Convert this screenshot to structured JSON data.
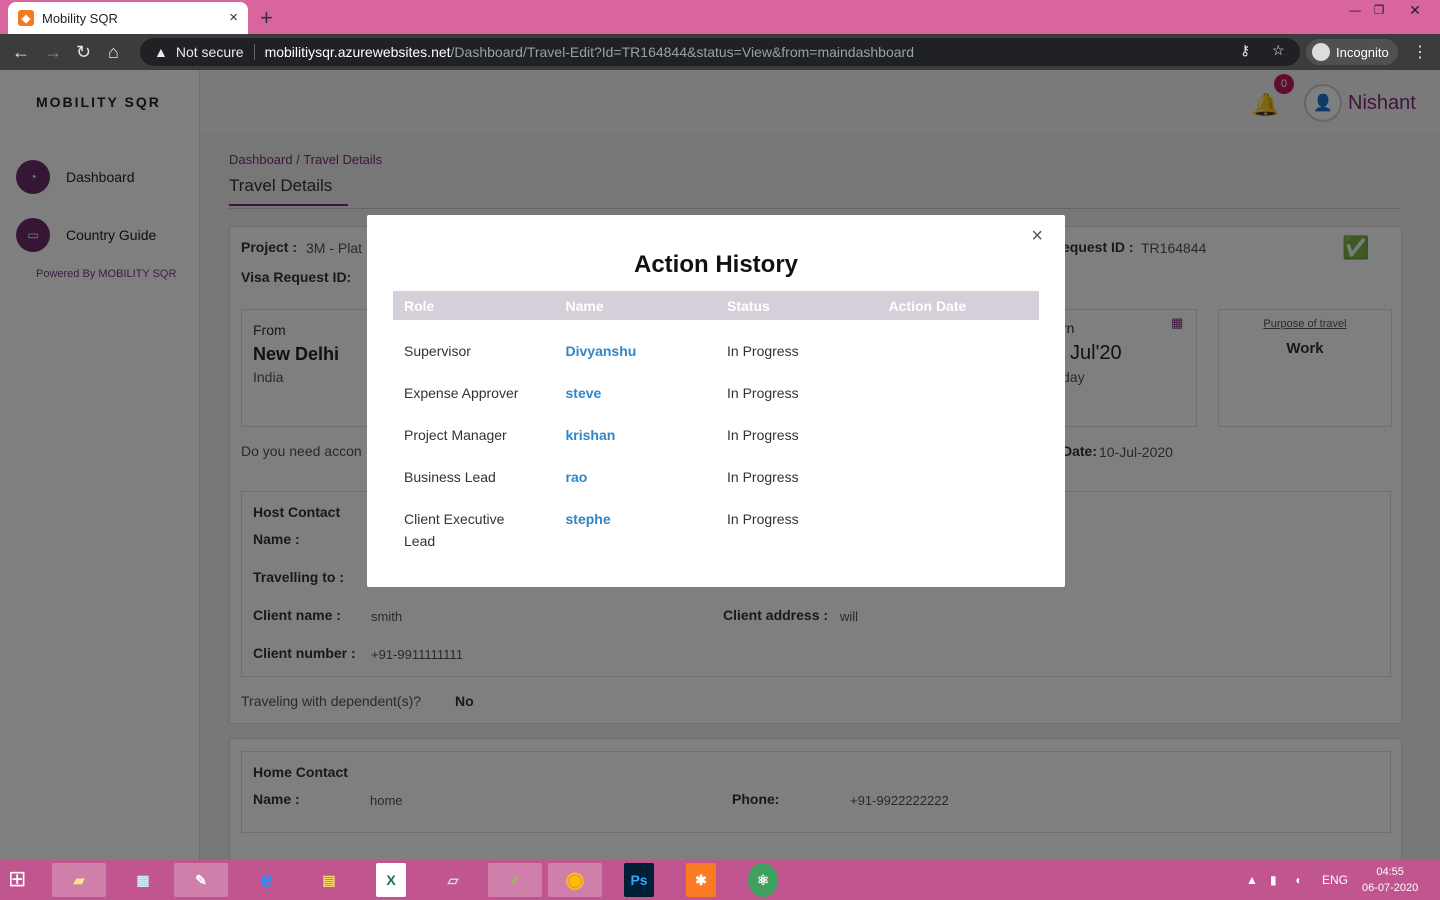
{
  "browser": {
    "tab_title": "Mobility SQR",
    "tab_close": "×",
    "new_tab": "+",
    "security_label": "Not secure",
    "url_host": "mobilitiysqr.azurewebsites.net",
    "url_path": "/Dashboard/Travel-Edit?Id=TR164844&status=View&from=maindashboard",
    "incognito_label": "Incognito"
  },
  "sidebar": {
    "logo": "MOBILITY SQR",
    "items": [
      {
        "label": "Dashboard",
        "icon": "dashboard-icon"
      },
      {
        "label": "Country Guide",
        "icon": "visa-icon"
      }
    ],
    "powered_by": "Powered By MOBILITY SQR"
  },
  "header": {
    "notification_count": "0",
    "user_name": "Nishant"
  },
  "page": {
    "breadcrumb": "Dashboard / Travel Details",
    "title": "Travel Details",
    "project_label": "Project :",
    "project_value": "3M - Plat",
    "visa_request_label": "Visa Request ID:",
    "request_id_label": "equest ID :",
    "request_id_value": "TR164844",
    "from_label": "From",
    "from_city": "New Delhi",
    "from_country": "India",
    "return_label": "rn",
    "return_date": "Jul'20",
    "return_day": "day",
    "purpose_label": "Purpose of travel",
    "purpose_value": "Work",
    "accommodation_q": "Do you need accon",
    "date_label": "Date:",
    "date_value": "10-Jul-2020",
    "host_contact": {
      "title": "Host Contact",
      "name_label": "Name :",
      "travelling_label": "Travelling to :",
      "client_name_label": "Client name :",
      "client_name": "smith",
      "client_address_label": "Client address :",
      "client_address": "will",
      "client_number_label": "Client number :",
      "client_number": "+91-9911111111"
    },
    "dependents_q": "Traveling with dependent(s)?",
    "dependents_a": "No",
    "home_contact": {
      "title": "Home Contact",
      "name_label": "Name :",
      "name": "home",
      "phone_label": "Phone:",
      "phone": "+91-9922222222"
    }
  },
  "modal": {
    "title": "Action History",
    "close": "×",
    "columns": [
      "Role",
      "Name",
      "Status",
      "Action Date"
    ],
    "rows": [
      {
        "role": "Supervisor",
        "name": "Divyanshu",
        "status": "In Progress",
        "date": ""
      },
      {
        "role": "Expense Approver",
        "name": "steve",
        "status": "In Progress",
        "date": ""
      },
      {
        "role": "Project Manager",
        "name": "krishan",
        "status": "In Progress",
        "date": ""
      },
      {
        "role": "Business Lead",
        "name": "rao",
        "status": "In Progress",
        "date": ""
      },
      {
        "role": "Client Executive Lead",
        "name": "stephe",
        "status": "In Progress",
        "date": ""
      }
    ]
  },
  "taskbar": {
    "language": "ENG",
    "time": "04:55",
    "date": "06-07-2020"
  },
  "colors": {
    "brand": "#7b2b7b",
    "link": "#2f86c8",
    "table_header": "#d5cfd9",
    "chrome_tab_bar": "#d9659f"
  }
}
